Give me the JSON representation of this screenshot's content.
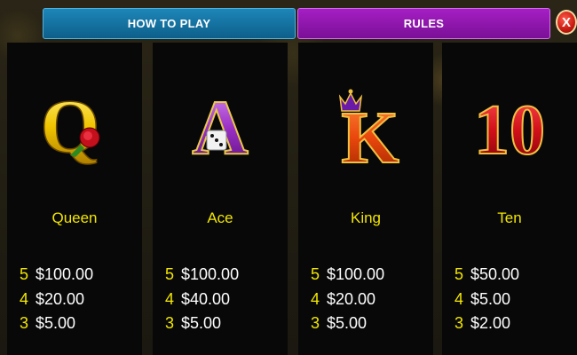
{
  "tabs": {
    "how_to_play": "HOW TO PLAY",
    "rules": "RULES"
  },
  "close_label": "X",
  "colors": {
    "name": "#f2e600",
    "value": "#ffffff",
    "how_tab": "#0d5f8a",
    "rules_tab": "#7a0f96"
  },
  "symbols": [
    {
      "icon": "queen-q-rose-icon",
      "glyph": "Q",
      "name": "Queen",
      "pays": [
        {
          "count": "5",
          "value": "$100.00"
        },
        {
          "count": "4",
          "value": "$20.00"
        },
        {
          "count": "3",
          "value": "$5.00"
        }
      ]
    },
    {
      "icon": "ace-a-dice-icon",
      "glyph": "A",
      "name": "Ace",
      "pays": [
        {
          "count": "5",
          "value": "$100.00"
        },
        {
          "count": "4",
          "value": "$40.00"
        },
        {
          "count": "3",
          "value": "$5.00"
        }
      ]
    },
    {
      "icon": "king-k-crown-icon",
      "glyph": "K",
      "name": "King",
      "pays": [
        {
          "count": "5",
          "value": "$100.00"
        },
        {
          "count": "4",
          "value": "$20.00"
        },
        {
          "count": "3",
          "value": "$5.00"
        }
      ]
    },
    {
      "icon": "ten-10-icon",
      "glyph": "10",
      "name": "Ten",
      "pays": [
        {
          "count": "5",
          "value": "$50.00"
        },
        {
          "count": "4",
          "value": "$5.00"
        },
        {
          "count": "3",
          "value": "$2.00"
        }
      ]
    }
  ]
}
